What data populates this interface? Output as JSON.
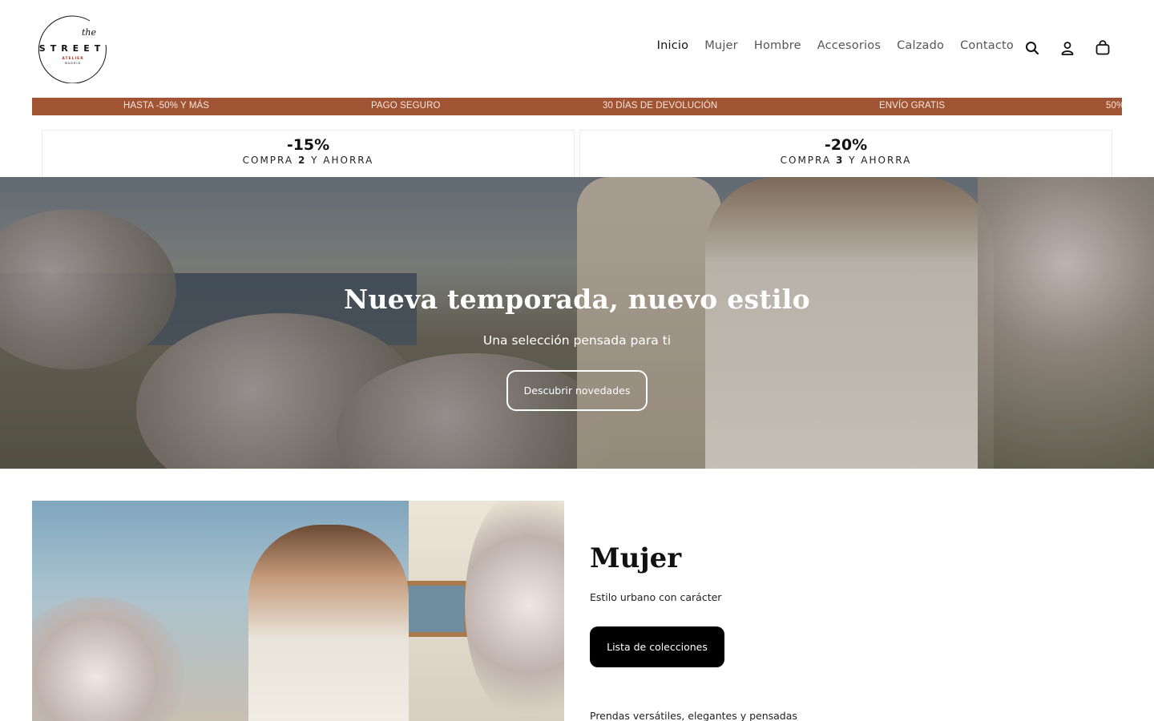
{
  "header": {
    "logo": {
      "script_word": "the",
      "name": "STREET",
      "sub1": "ATELIER",
      "sub2": "MADRID"
    },
    "nav": [
      {
        "label": "Inicio"
      },
      {
        "label": "Mujer"
      },
      {
        "label": "Hombre"
      },
      {
        "label": "Accesorios"
      },
      {
        "label": "Calzado"
      },
      {
        "label": "Contacto"
      }
    ],
    "icons": [
      "search-icon",
      "account-icon",
      "cart-icon"
    ]
  },
  "ticker": {
    "items": [
      "HASTA -50% Y MÁS",
      "PAGO SEGURO",
      "30 DÍAS DE DEVOLUCIÓN",
      "ENVÍO GRATIS",
      "50%"
    ],
    "background": "#a05434"
  },
  "promos": [
    {
      "percent": "-15%",
      "text_before": "COMPRA",
      "qty": "2",
      "text_after": "Y AHORRA"
    },
    {
      "percent": "-20%",
      "text_before": "COMPRA",
      "qty": "3",
      "text_after": "Y AHORRA"
    }
  ],
  "hero": {
    "title": "Nueva temporada, nuevo estilo",
    "subtitle": "Una selección pensada para ti",
    "button": "Descubrir novedades"
  },
  "collection": {
    "title": "Mujer",
    "subtitle": "Estilo urbano con carácter",
    "button": "Lista de colecciones",
    "description": "Prendas versátiles, elegantes y pensadas"
  }
}
